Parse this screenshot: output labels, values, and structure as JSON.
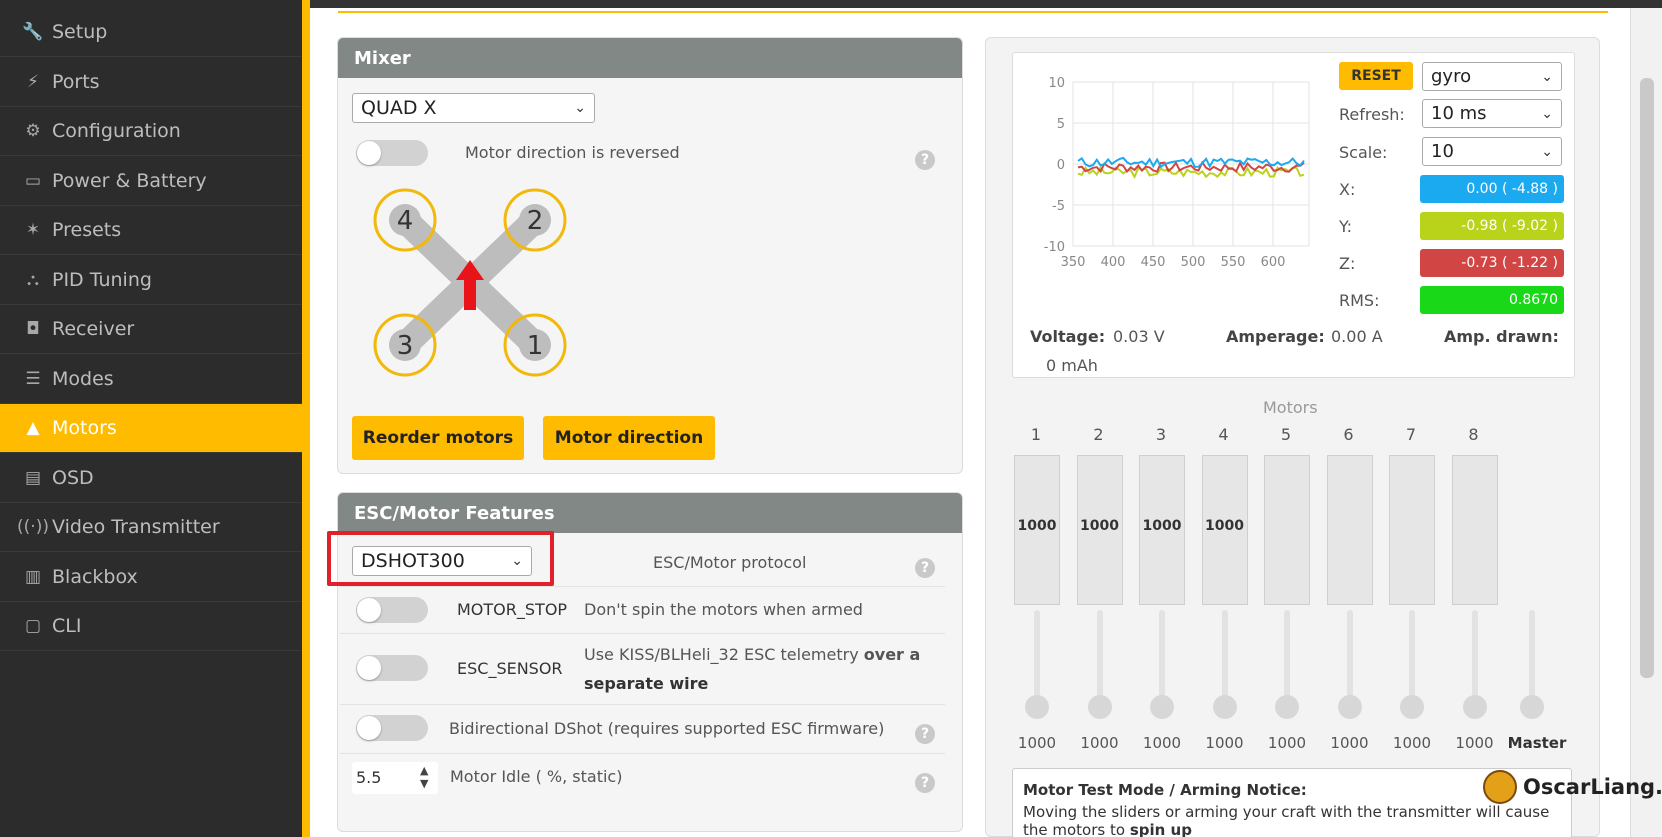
{
  "sidebar": {
    "items": [
      {
        "label": "Setup",
        "icon": "wrench-icon",
        "glyph": "🔧"
      },
      {
        "label": "Ports",
        "icon": "plug-icon",
        "glyph": "⚡"
      },
      {
        "label": "Configuration",
        "icon": "gear-icon",
        "glyph": "⚙"
      },
      {
        "label": "Power & Battery",
        "icon": "battery-icon",
        "glyph": "▭"
      },
      {
        "label": "Presets",
        "icon": "magic-wand-icon",
        "glyph": "✶"
      },
      {
        "label": "PID Tuning",
        "icon": "sitemap-icon",
        "glyph": "⛬"
      },
      {
        "label": "Receiver",
        "icon": "robot-icon",
        "glyph": "◘"
      },
      {
        "label": "Modes",
        "icon": "toggles-icon",
        "glyph": "☰"
      },
      {
        "label": "Motors",
        "icon": "motor-icon",
        "glyph": "▲"
      },
      {
        "label": "OSD",
        "icon": "osd-icon",
        "glyph": "▤"
      },
      {
        "label": "Video Transmitter",
        "icon": "broadcast-icon",
        "glyph": "((·))"
      },
      {
        "label": "Blackbox",
        "icon": "blackbox-icon",
        "glyph": "▥"
      },
      {
        "label": "CLI",
        "icon": "terminal-icon",
        "glyph": "▢"
      }
    ],
    "active_index": 8
  },
  "mixer": {
    "title": "Mixer",
    "mixer_type": "QUAD X",
    "motor_direction_reversed_label": "Motor direction is reversed",
    "motor_labels": [
      "4",
      "2",
      "3",
      "1"
    ],
    "reorder_label": "Reorder motors",
    "direction_label": "Motor direction"
  },
  "esc": {
    "title": "ESC/Motor Features",
    "protocol_value": "DSHOT300",
    "protocol_label": "ESC/Motor protocol",
    "motor_stop_name": "MOTOR_STOP",
    "motor_stop_desc": "Don't spin the motors when armed",
    "esc_sensor_name": "ESC_SENSOR",
    "esc_sensor_desc_1": "Use KISS/BLHeli_32 ESC telemetry",
    "esc_sensor_desc_bold_1": "over a",
    "esc_sensor_desc_bold_2": "separate wire",
    "bidir_label": "Bidirectional DShot (requires supported ESC firmware)",
    "idle_value": "5.5",
    "idle_label": "Motor Idle ( %, static)"
  },
  "graph": {
    "reset_label": "RESET",
    "sensor_value": "gyro",
    "refresh_label": "Refresh:",
    "refresh_value": "10 ms",
    "scale_label": "Scale:",
    "scale_value": "10",
    "x_label": "X:",
    "x_value": "0.00 ( -4.88 )",
    "y_label": "Y:",
    "y_value": "-0.98 ( -9.02 )",
    "z_label": "Z:",
    "z_value": "-0.73 ( -1.22 )",
    "rms_label": "RMS:",
    "rms_value": "0.8670",
    "colors": {
      "x": "#1ba9f0",
      "y": "#b9d21a",
      "z": "#d14545",
      "rms": "#18d818"
    },
    "y_ticks": [
      "10",
      "5",
      "0",
      "-5",
      "-10"
    ],
    "x_ticks": [
      "350",
      "400",
      "450",
      "500",
      "550",
      "600"
    ]
  },
  "power": {
    "voltage_label": "Voltage:",
    "voltage_value": "0.03 V",
    "amperage_label": "Amperage:",
    "amperage_value": "0.00 A",
    "amp_drawn_label": "Amp. drawn:",
    "amp_drawn_value": "0 mAh"
  },
  "motors": {
    "title": "Motors",
    "numbers": [
      "1",
      "2",
      "3",
      "4",
      "5",
      "6",
      "7",
      "8"
    ],
    "bar_values": [
      "1000",
      "1000",
      "1000",
      "1000",
      "",
      "",
      "",
      ""
    ],
    "slider_values": [
      "1000",
      "1000",
      "1000",
      "1000",
      "1000",
      "1000",
      "1000",
      "1000"
    ],
    "master_label": "Master"
  },
  "notice": {
    "title": "Motor Test Mode / Arming Notice:",
    "text": "Moving the sliders or arming your craft with the transmitter will cause the motors to",
    "bold_end": "spin up"
  },
  "watermark": {
    "text": "OscarLiang.com"
  }
}
